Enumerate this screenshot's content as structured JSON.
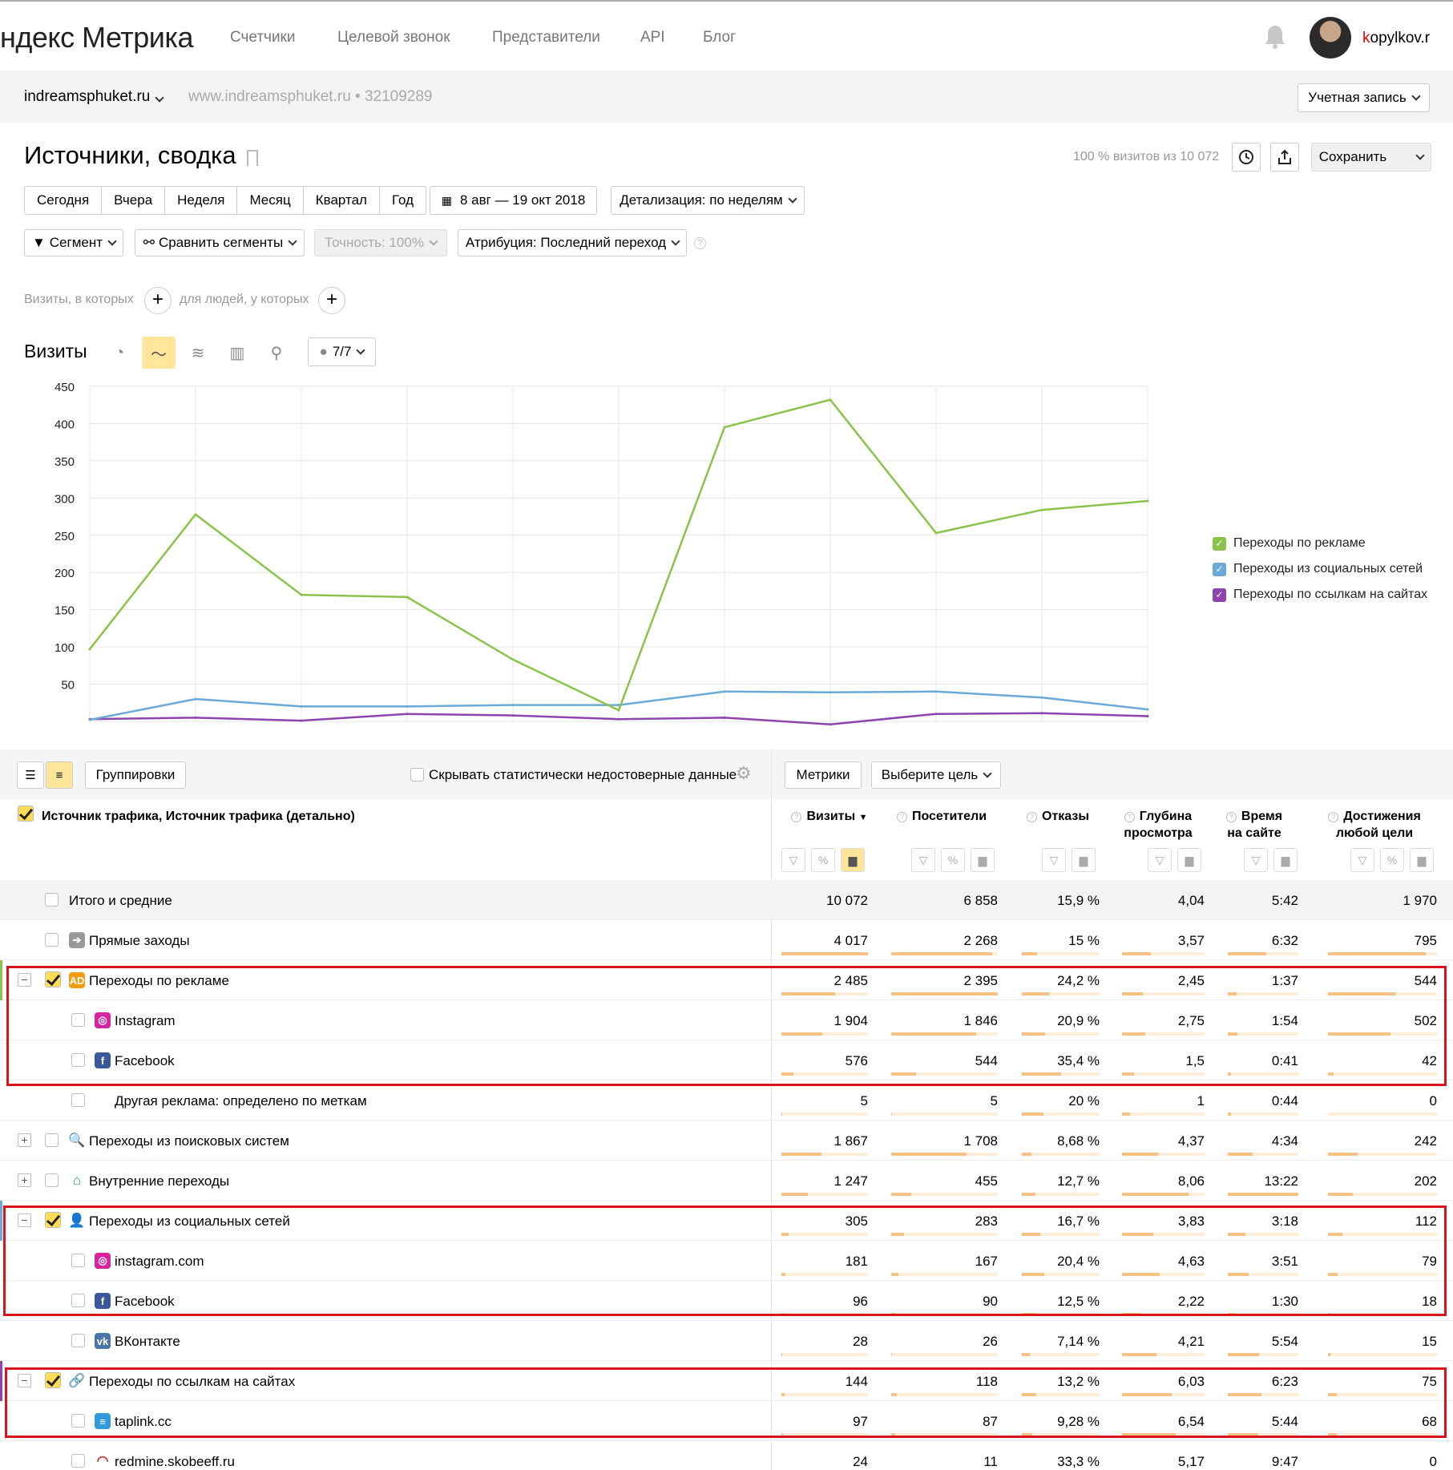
{
  "header": {
    "logo": "ндекс Метрика",
    "nav": [
      "Счетчики",
      "Целевой звонок",
      "Представители",
      "API",
      "Блог"
    ],
    "user_first": "k",
    "user_rest": "opylkov.r"
  },
  "counter": {
    "name": "indreamsphuket.ru",
    "meta": "www.indreamsphuket.ru • 32109289",
    "account_button": "Учетная запись"
  },
  "report": {
    "title": "Источники, сводка",
    "visits_share": "100 % визитов из 10 072",
    "save_button": "Сохранить",
    "periods": [
      "Сегодня",
      "Вчера",
      "Неделя",
      "Месяц",
      "Квартал",
      "Год"
    ],
    "date_range": "8 авг — 19 окт 2018",
    "detail": "Детализация: по неделям",
    "segment": "Сегмент",
    "compare": "Сравнить сегменты",
    "accuracy": "Точность: 100%",
    "attribution": "Атрибуция: Последний переход",
    "filter_visits": "Визиты, в которых",
    "filter_people": "для людей, у которых",
    "chart_label": "Визиты",
    "series_selector": "7/7"
  },
  "chart_data": {
    "type": "line",
    "x": [
      1,
      2,
      3,
      4,
      5,
      6,
      7,
      8,
      9,
      10,
      11
    ],
    "ylim": [
      0,
      450
    ],
    "yticks": [
      50,
      100,
      150,
      200,
      250,
      300,
      350,
      400,
      450
    ],
    "grid": true,
    "legend_position": "right",
    "series": [
      {
        "name": "Переходы по рекламе",
        "color": "#8bc34a",
        "values": [
          97,
          278,
          170,
          167,
          83,
          15,
          395,
          432,
          253,
          284,
          296
        ]
      },
      {
        "name": "Переходы из социальных сетей",
        "color": "#6aa9d8",
        "values": [
          2,
          30,
          20,
          20,
          22,
          22,
          40,
          39,
          40,
          32,
          16
        ]
      },
      {
        "name": "Переходы по ссылкам на сайтах",
        "color": "#8e44ad",
        "values": [
          3,
          5,
          1,
          10,
          8,
          3,
          5,
          -4,
          10,
          11,
          7
        ]
      }
    ]
  },
  "table": {
    "view_groupings": "Группировки",
    "hide_unreliable": "Скрывать статистически недостоверные данные",
    "metrics_button": "Метрики",
    "goal_button": "Выберите цель",
    "dimension_header": "Источник трафика, Источник трафика (детально)",
    "columns": [
      {
        "line1": "Визиты",
        "line2": "",
        "sorted": "▼"
      },
      {
        "line1": "Посетители",
        "line2": ""
      },
      {
        "line1": "Отказы",
        "line2": ""
      },
      {
        "line1": "Глубина",
        "line2": "просмотра"
      },
      {
        "line1": "Время",
        "line2": "на сайте"
      },
      {
        "line1": "Достижения",
        "line2": "любой цели"
      }
    ],
    "rows": [
      {
        "name": "Итого и средние",
        "values": [
          "10 072",
          "6 858",
          "15,9 %",
          "4,04",
          "5:42",
          "1 970"
        ],
        "bars": null
      },
      {
        "name": "Прямые заходы",
        "values": [
          "4 017",
          "2 268",
          "15 %",
          "3,57",
          "6:32",
          "795"
        ],
        "bars": [
          1.0,
          0.95,
          0.2,
          0.35,
          0.55,
          0.9
        ]
      },
      {
        "name": "Переходы по рекламе",
        "values": [
          "2 485",
          "2 395",
          "24,2 %",
          "2,45",
          "1:37",
          "544"
        ],
        "bars": [
          0.62,
          1.0,
          0.35,
          0.25,
          0.12,
          0.62
        ]
      },
      {
        "name": "Instagram",
        "values": [
          "1 904",
          "1 846",
          "20,9 %",
          "2,75",
          "1:54",
          "502"
        ],
        "bars": [
          0.47,
          0.8,
          0.3,
          0.28,
          0.14,
          0.57
        ]
      },
      {
        "name": "Facebook",
        "values": [
          "576",
          "544",
          "35,4 %",
          "1,5",
          "0:41",
          "42"
        ],
        "bars": [
          0.14,
          0.23,
          0.5,
          0.15,
          0.05,
          0.05
        ]
      },
      {
        "name": "Другая реклама: определено по меткам",
        "values": [
          "5",
          "5",
          "20 %",
          "1",
          "0:44",
          "0"
        ],
        "bars": [
          0.01,
          0.01,
          0.28,
          0.1,
          0.05,
          0.0
        ]
      },
      {
        "name": "Переходы из поисковых систем",
        "values": [
          "1 867",
          "1 708",
          "8,68 %",
          "4,37",
          "4:34",
          "242"
        ],
        "bars": [
          0.46,
          0.71,
          0.12,
          0.44,
          0.35,
          0.27
        ]
      },
      {
        "name": "Внутренние переходы",
        "values": [
          "1 247",
          "455",
          "12,7 %",
          "8,06",
          "13:22",
          "202"
        ],
        "bars": [
          0.31,
          0.19,
          0.18,
          0.81,
          1.0,
          0.23
        ]
      },
      {
        "name": "Переходы из социальных сетей",
        "values": [
          "305",
          "283",
          "16,7 %",
          "3,83",
          "3:18",
          "112"
        ],
        "bars": [
          0.08,
          0.12,
          0.24,
          0.38,
          0.25,
          0.13
        ]
      },
      {
        "name": "instagram.com",
        "values": [
          "181",
          "167",
          "20,4 %",
          "4,63",
          "3:51",
          "79"
        ],
        "bars": [
          0.05,
          0.07,
          0.29,
          0.46,
          0.29,
          0.09
        ]
      },
      {
        "name": "Facebook",
        "values": [
          "96",
          "90",
          "12,5 %",
          "2,22",
          "1:30",
          "18"
        ],
        "bars": [
          0.02,
          0.04,
          0.18,
          0.22,
          0.11,
          0.02
        ]
      },
      {
        "name": "ВКонтакте",
        "values": [
          "28",
          "26",
          "7,14 %",
          "4,21",
          "5:54",
          "15"
        ],
        "bars": [
          0.01,
          0.01,
          0.1,
          0.42,
          0.44,
          0.02
        ]
      },
      {
        "name": "Переходы по ссылкам на сайтах",
        "values": [
          "144",
          "118",
          "13,2 %",
          "6,03",
          "6:23",
          "75"
        ],
        "bars": [
          0.04,
          0.05,
          0.19,
          0.6,
          0.48,
          0.08
        ]
      },
      {
        "name": "taplink.cc",
        "values": [
          "97",
          "87",
          "9,28 %",
          "6,54",
          "5:44",
          "68"
        ],
        "bars": [
          0.02,
          0.04,
          0.13,
          0.65,
          0.43,
          0.08
        ]
      },
      {
        "name": "redmine.skobeeff.ru",
        "values": [
          "24",
          "11",
          "33,3 %",
          "5,17",
          "9:47",
          "0"
        ],
        "bars": [
          0.01,
          0.0,
          0.47,
          0.5,
          0.73,
          0.0
        ]
      }
    ]
  }
}
